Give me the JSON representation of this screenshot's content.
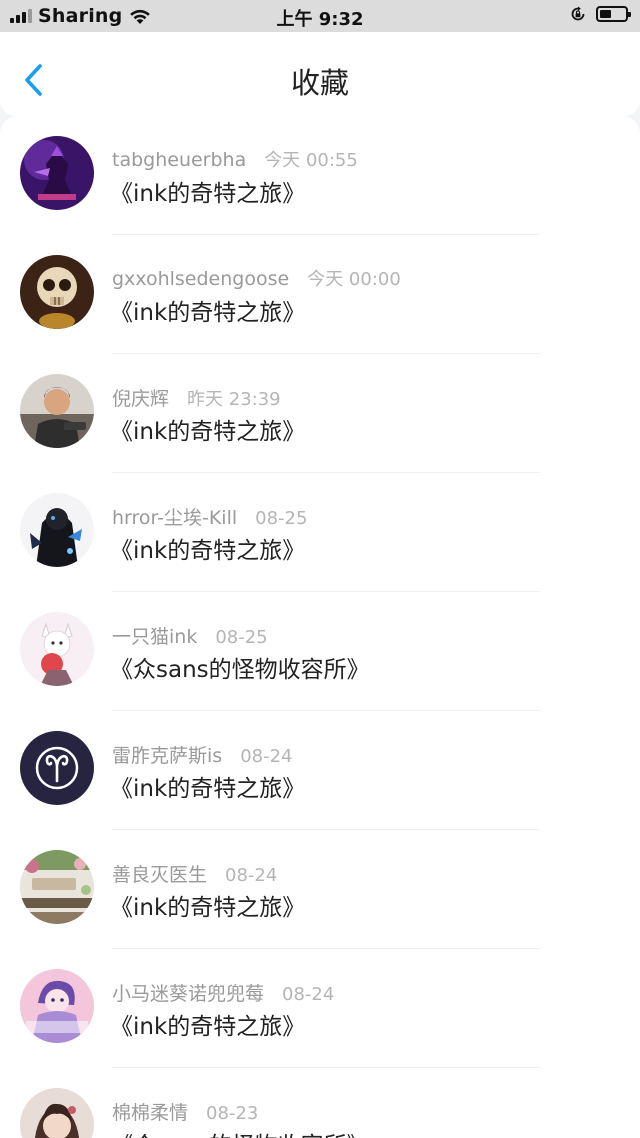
{
  "status_bar": {
    "carrier": "Sharing",
    "time": "上午 9:32",
    "battery_level": 0.45,
    "icons": [
      "signal-icon",
      "wifi-icon",
      "rotation-lock-icon",
      "battery-icon"
    ]
  },
  "nav": {
    "back_icon": "chevron-left-icon",
    "title": "收藏",
    "accent_color": "#1a9cf0"
  },
  "favorites": [
    {
      "username": "tabgheuerbha",
      "time": "今天 00:55",
      "title": "《ink的奇特之旅》",
      "avatar": "purple-armored-character"
    },
    {
      "username": "gxxohlsedengoose",
      "time": "今天 00:00",
      "title": "《ink的奇特之旅》",
      "avatar": "skull-character"
    },
    {
      "username": "倪庆辉",
      "time": "昨天 23:39",
      "title": "《ink的奇特之旅》",
      "avatar": "person-photo"
    },
    {
      "username": "hrror-尘埃-Kill",
      "time": "08-25",
      "title": "《ink的奇特之旅》",
      "avatar": "dark-anime-character"
    },
    {
      "username": "一只猫ink",
      "time": "08-25",
      "title": "《众sans的怪物收容所》",
      "avatar": "white-cat-character"
    },
    {
      "username": "雷胙克萨斯is",
      "time": "08-24",
      "title": "《ink的奇特之旅》",
      "avatar": "aries-symbol"
    },
    {
      "username": "善良灭医生",
      "time": "08-24",
      "title": "《ink的奇特之旅》",
      "avatar": "flowers-shop-photo"
    },
    {
      "username": "小马迷葵诺兜兜莓",
      "time": "08-24",
      "title": "《ink的奇特之旅》",
      "avatar": "pink-pony-character"
    },
    {
      "username": "棉棉柔情",
      "time": "08-23",
      "title": "《众sans的怪物收容所》",
      "avatar": "girl-portrait"
    }
  ]
}
